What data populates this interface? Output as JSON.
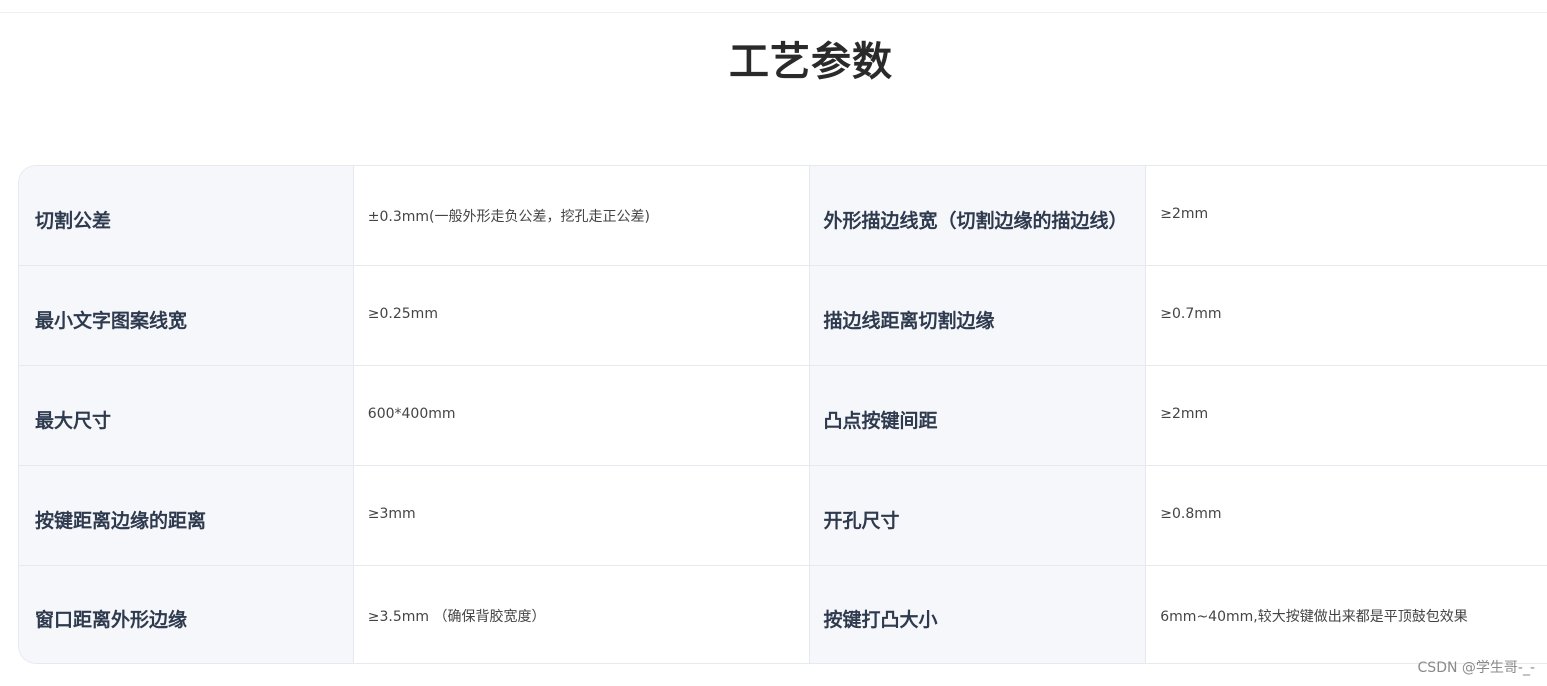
{
  "page": {
    "title": "工艺参数"
  },
  "table": {
    "rows": [
      {
        "label1": "切割公差",
        "value1": "±0.3mm(一般外形走负公差，挖孔走正公差)",
        "label2": "外形描边线宽（切割边缘的描边线）",
        "value2": "≥2mm"
      },
      {
        "label1": "最小文字图案线宽",
        "value1": "≥0.25mm",
        "label2": "描边线距离切割边缘",
        "value2": "≥0.7mm"
      },
      {
        "label1": "最大尺寸",
        "value1": "600*400mm",
        "label2": "凸点按键间距",
        "value2": "≥2mm"
      },
      {
        "label1": "按键距离边缘的距离",
        "value1": "≥3mm",
        "label2": "开孔尺寸",
        "value2": "≥0.8mm"
      },
      {
        "label1": "窗口距离外形边缘",
        "value1": "≥3.5mm （确保背胶宽度）",
        "label2": "按键打凸大小",
        "value2": "6mm~40mm,较大按键做出来都是平顶鼓包效果"
      }
    ]
  },
  "watermark": {
    "text": "CSDN @学生哥-_-"
  },
  "colors": {
    "label_bg": "#f6f7fb",
    "border": "#e6e9f0",
    "label_text": "#2e3a4e"
  }
}
